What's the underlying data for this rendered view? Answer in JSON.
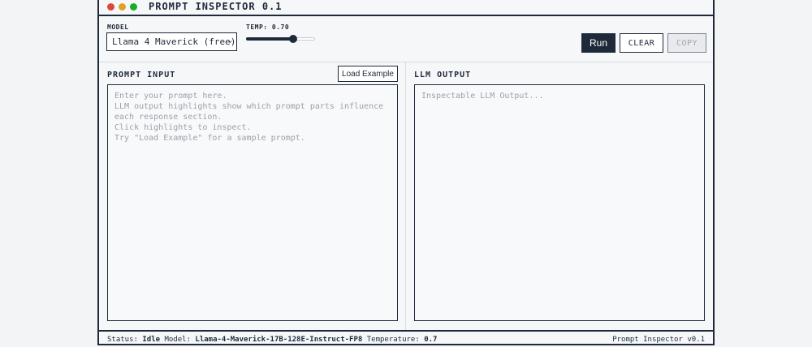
{
  "window": {
    "title": "PROMPT INSPECTOR 0.1",
    "dots": [
      "#e0443e",
      "#dea123",
      "#1aab29"
    ]
  },
  "toolbar": {
    "model_label": "MODEL",
    "model_value": "Llama 4 Maverick (free)",
    "temp_label": "TEMP: 0.70",
    "temp_value": 0.7,
    "run_label": "Run",
    "clear_label": "CLEAR",
    "copy_label": "COPY"
  },
  "prompt": {
    "title": "PROMPT INPUT",
    "load_label": "Load Example",
    "placeholder": "Enter your prompt here.\nLLM output highlights show which prompt parts influence each response section.\nClick highlights to inspect.\nTry \"Load Example\" for a sample prompt."
  },
  "output": {
    "title": "LLM OUTPUT",
    "placeholder": "Inspectable LLM Output..."
  },
  "status": {
    "status_key": "Status:",
    "status_value": "Idle",
    "model_key": "Model:",
    "model_value": "Llama-4-Maverick-17B-128E-Instruct-FP8",
    "temp_key": "Temperature:",
    "temp_value": "0.7",
    "version": "Prompt Inspector v0.1"
  },
  "colors": {
    "ink": "#1e2a3a",
    "muted": "#9ba1a9"
  }
}
